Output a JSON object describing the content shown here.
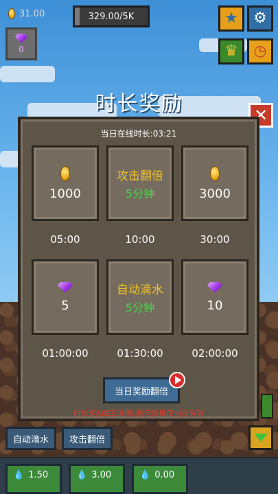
{
  "hud": {
    "coins": "31.00",
    "gems": "0",
    "progress_text": "329.00/5K",
    "progress_fraction": 0.0658
  },
  "title": "时长奖励",
  "dialog": {
    "online_time": "当日在线时长:03:21",
    "rewards": [
      {
        "icon": "coin-icon",
        "amount": "1000",
        "time": "05:00"
      },
      {
        "icon": "none",
        "label": "攻击翻倍",
        "duration": "5分钟",
        "time": "10:00"
      },
      {
        "icon": "coin-icon",
        "amount": "3000",
        "time": "30:00"
      },
      {
        "icon": "gem-icon",
        "amount": "5",
        "time": "01:00:00"
      },
      {
        "icon": "none",
        "label": "自动滴水",
        "duration": "5分钟",
        "time": "01:30:00"
      },
      {
        "icon": "gem-icon",
        "amount": "10",
        "time": "02:00:00"
      }
    ],
    "double_button": "当日奖励翻倍",
    "notice": "时长奖励每日刷新,翻倍效果仅当日有效"
  },
  "controls": {
    "auto_drip": "自动滴水",
    "attack_double": "攻击翻倍"
  },
  "slots": [
    {
      "value": "1.50"
    },
    {
      "value": "3.00"
    },
    {
      "value": "0.00"
    }
  ],
  "colors": {
    "accent_yellow": "#f2c22a",
    "accent_green": "#4bd44a",
    "notice_red": "#e23a2a",
    "dialog_bg": "#5e5549"
  }
}
